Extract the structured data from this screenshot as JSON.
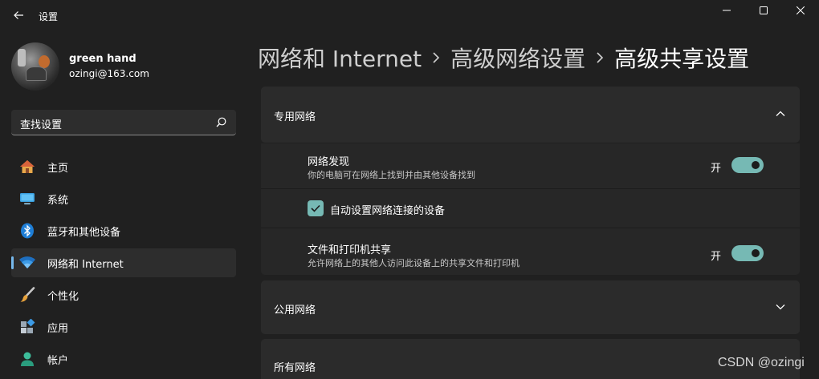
{
  "window": {
    "title": "设置",
    "back_icon": "back-arrow-icon",
    "controls": [
      "minimize-icon",
      "maximize-icon",
      "close-icon"
    ]
  },
  "profile": {
    "name": "green hand",
    "email": "ozingi@163.com"
  },
  "search": {
    "placeholder": "查找设置",
    "icon": "search-icon"
  },
  "nav": {
    "items": [
      {
        "label": "主页",
        "icon": "home-icon",
        "active": false
      },
      {
        "label": "系统",
        "icon": "system-monitor-icon",
        "active": false
      },
      {
        "label": "蓝牙和其他设备",
        "icon": "bluetooth-icon",
        "active": false
      },
      {
        "label": "网络和 Internet",
        "icon": "wifi-icon",
        "active": true
      },
      {
        "label": "个性化",
        "icon": "brush-icon",
        "active": false
      },
      {
        "label": "应用",
        "icon": "apps-icon",
        "active": false
      },
      {
        "label": "帐户",
        "icon": "account-icon",
        "active": false
      }
    ]
  },
  "breadcrumb": {
    "items": [
      "网络和 Internet",
      "高级网络设置",
      "高级共享设置"
    ]
  },
  "sections": {
    "private": {
      "title": "专用网络",
      "expanded": true,
      "network_discovery": {
        "title": "网络发现",
        "desc": "你的电脑可在网络上找到并由其他设备找到",
        "state_label": "开",
        "on": true
      },
      "auto_setup": {
        "label": "自动设置网络连接的设备",
        "checked": true
      },
      "file_sharing": {
        "title": "文件和打印机共享",
        "desc": "允许网络上的其他人访问此设备上的共享文件和打印机",
        "state_label": "开",
        "on": true
      }
    },
    "public": {
      "title": "公用网络",
      "expanded": false
    },
    "all": {
      "title": "所有网络"
    }
  },
  "watermark": "CSDN @ozingi",
  "colors": {
    "background": "#202020",
    "card": "#2b2b2b",
    "accent": "#76b9b4",
    "nav_indicator": "#76b9ed"
  }
}
